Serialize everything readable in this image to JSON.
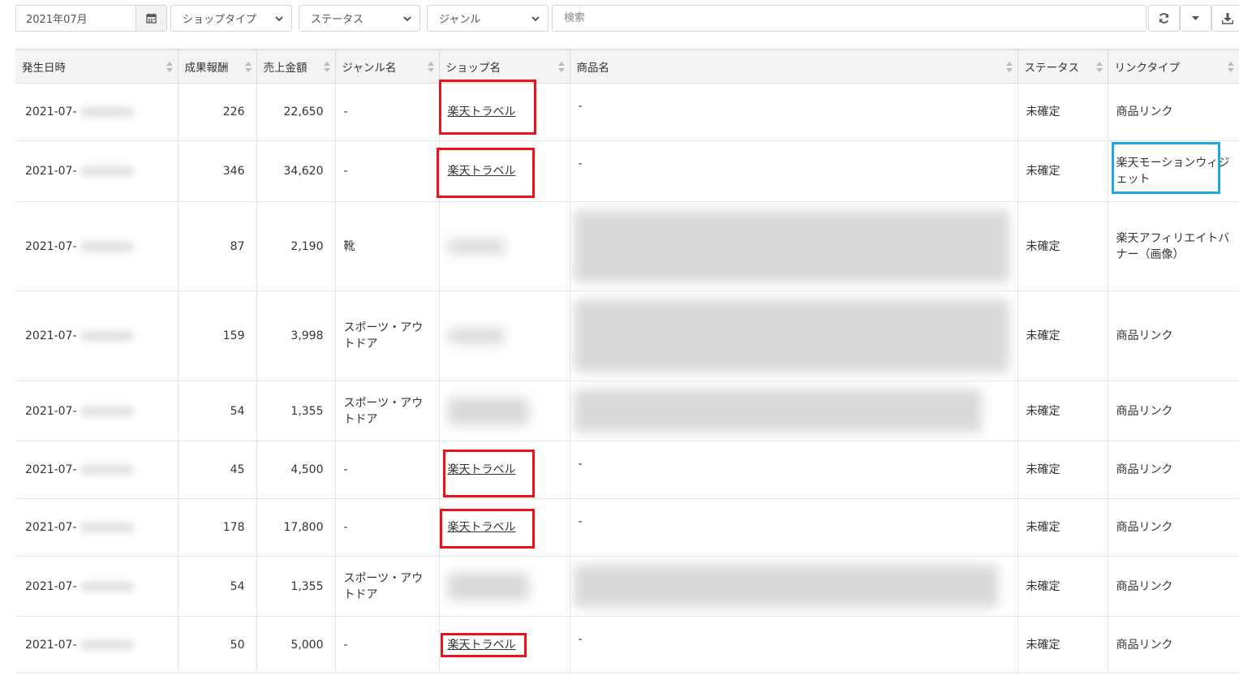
{
  "toolbar": {
    "date_value": "2021年07月",
    "shop_type_label": "ショップタイプ",
    "status_label": "ステータス",
    "genre_label": "ジャンル",
    "search_placeholder": "検索",
    "icons": [
      "calendar-icon",
      "chevron-down-icon",
      "refresh-icon",
      "caret-down-icon",
      "download-icon"
    ]
  },
  "table": {
    "columns": [
      "発生日時",
      "成果報酬",
      "売上金額",
      "ジャンル名",
      "ショップ名",
      "商品名",
      "ステータス",
      "リンクタイプ"
    ],
    "rows": [
      {
        "date": "2021-07-",
        "reward": "226",
        "sales": "22,650",
        "genre": "-",
        "shop": "楽天トラベル",
        "product": "-",
        "status": "未確定",
        "link_type": "商品リンク"
      },
      {
        "date": "2021-07-",
        "reward": "346",
        "sales": "34,620",
        "genre": "-",
        "shop": "楽天トラベル",
        "product": "-",
        "status": "未確定",
        "link_type": "楽天モーションウィジェット"
      },
      {
        "date": "2021-07-",
        "reward": "87",
        "sales": "2,190",
        "genre": "靴",
        "shop": "",
        "product": "",
        "status": "未確定",
        "link_type": "楽天アフィリエイトバナー（画像）"
      },
      {
        "date": "2021-07-",
        "reward": "159",
        "sales": "3,998",
        "genre": "スポーツ・アウトドア",
        "shop": "",
        "product": "",
        "status": "未確定",
        "link_type": "商品リンク"
      },
      {
        "date": "2021-07-",
        "reward": "54",
        "sales": "1,355",
        "genre": "スポーツ・アウトドア",
        "shop": "",
        "product": "",
        "status": "未確定",
        "link_type": "商品リンク"
      },
      {
        "date": "2021-07-",
        "reward": "45",
        "sales": "4,500",
        "genre": "-",
        "shop": "楽天トラベル",
        "product": "-",
        "status": "未確定",
        "link_type": "商品リンク"
      },
      {
        "date": "2021-07-",
        "reward": "178",
        "sales": "17,800",
        "genre": "-",
        "shop": "楽天トラベル",
        "product": "-",
        "status": "未確定",
        "link_type": "商品リンク"
      },
      {
        "date": "2021-07-",
        "reward": "54",
        "sales": "1,355",
        "genre": "スポーツ・アウトドア",
        "shop": "",
        "product": "",
        "status": "未確定",
        "link_type": "商品リンク"
      },
      {
        "date": "2021-07-",
        "reward": "50",
        "sales": "5,000",
        "genre": "-",
        "shop": "楽天トラベル",
        "product": "-",
        "status": "未確定",
        "link_type": "商品リンク"
      }
    ]
  },
  "annotations": {
    "highlight_red": "#e8131b",
    "highlight_blue": "#1ea9e0"
  }
}
